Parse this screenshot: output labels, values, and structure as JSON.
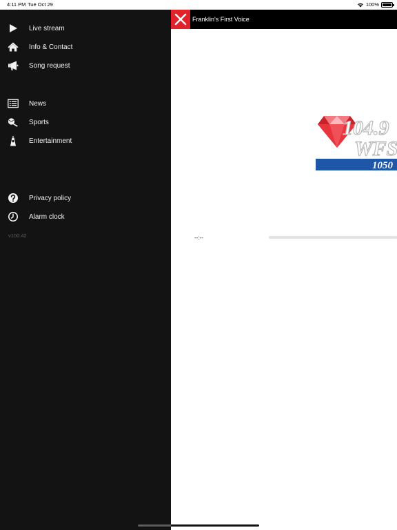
{
  "status_bar": {
    "time": "4:11 PM",
    "date": "Tue Oct 29",
    "battery": "100%"
  },
  "sidebar": {
    "items": [
      {
        "label": "Live stream",
        "icon": "play-icon"
      },
      {
        "label": "Info & Contact",
        "icon": "home-icon"
      },
      {
        "label": "Song request",
        "icon": "megaphone-icon"
      },
      {
        "label": "News",
        "icon": "newspaper-icon"
      },
      {
        "label": "Sports",
        "icon": "sports-icon"
      },
      {
        "label": "Entertainment",
        "icon": "entertainment-icon"
      },
      {
        "label": "Privacy policy",
        "icon": "question-icon"
      },
      {
        "label": "Alarm clock",
        "icon": "clock-icon"
      }
    ],
    "version": "v100.42"
  },
  "header": {
    "title": "Franklin's First Voice",
    "close_icon": "close-icon",
    "accent_color": "#e2222a"
  },
  "logo": {
    "frequency": "104.9",
    "call_letters": "WFS",
    "am": "1050"
  },
  "player": {
    "time": "--:--",
    "progress": 0
  }
}
